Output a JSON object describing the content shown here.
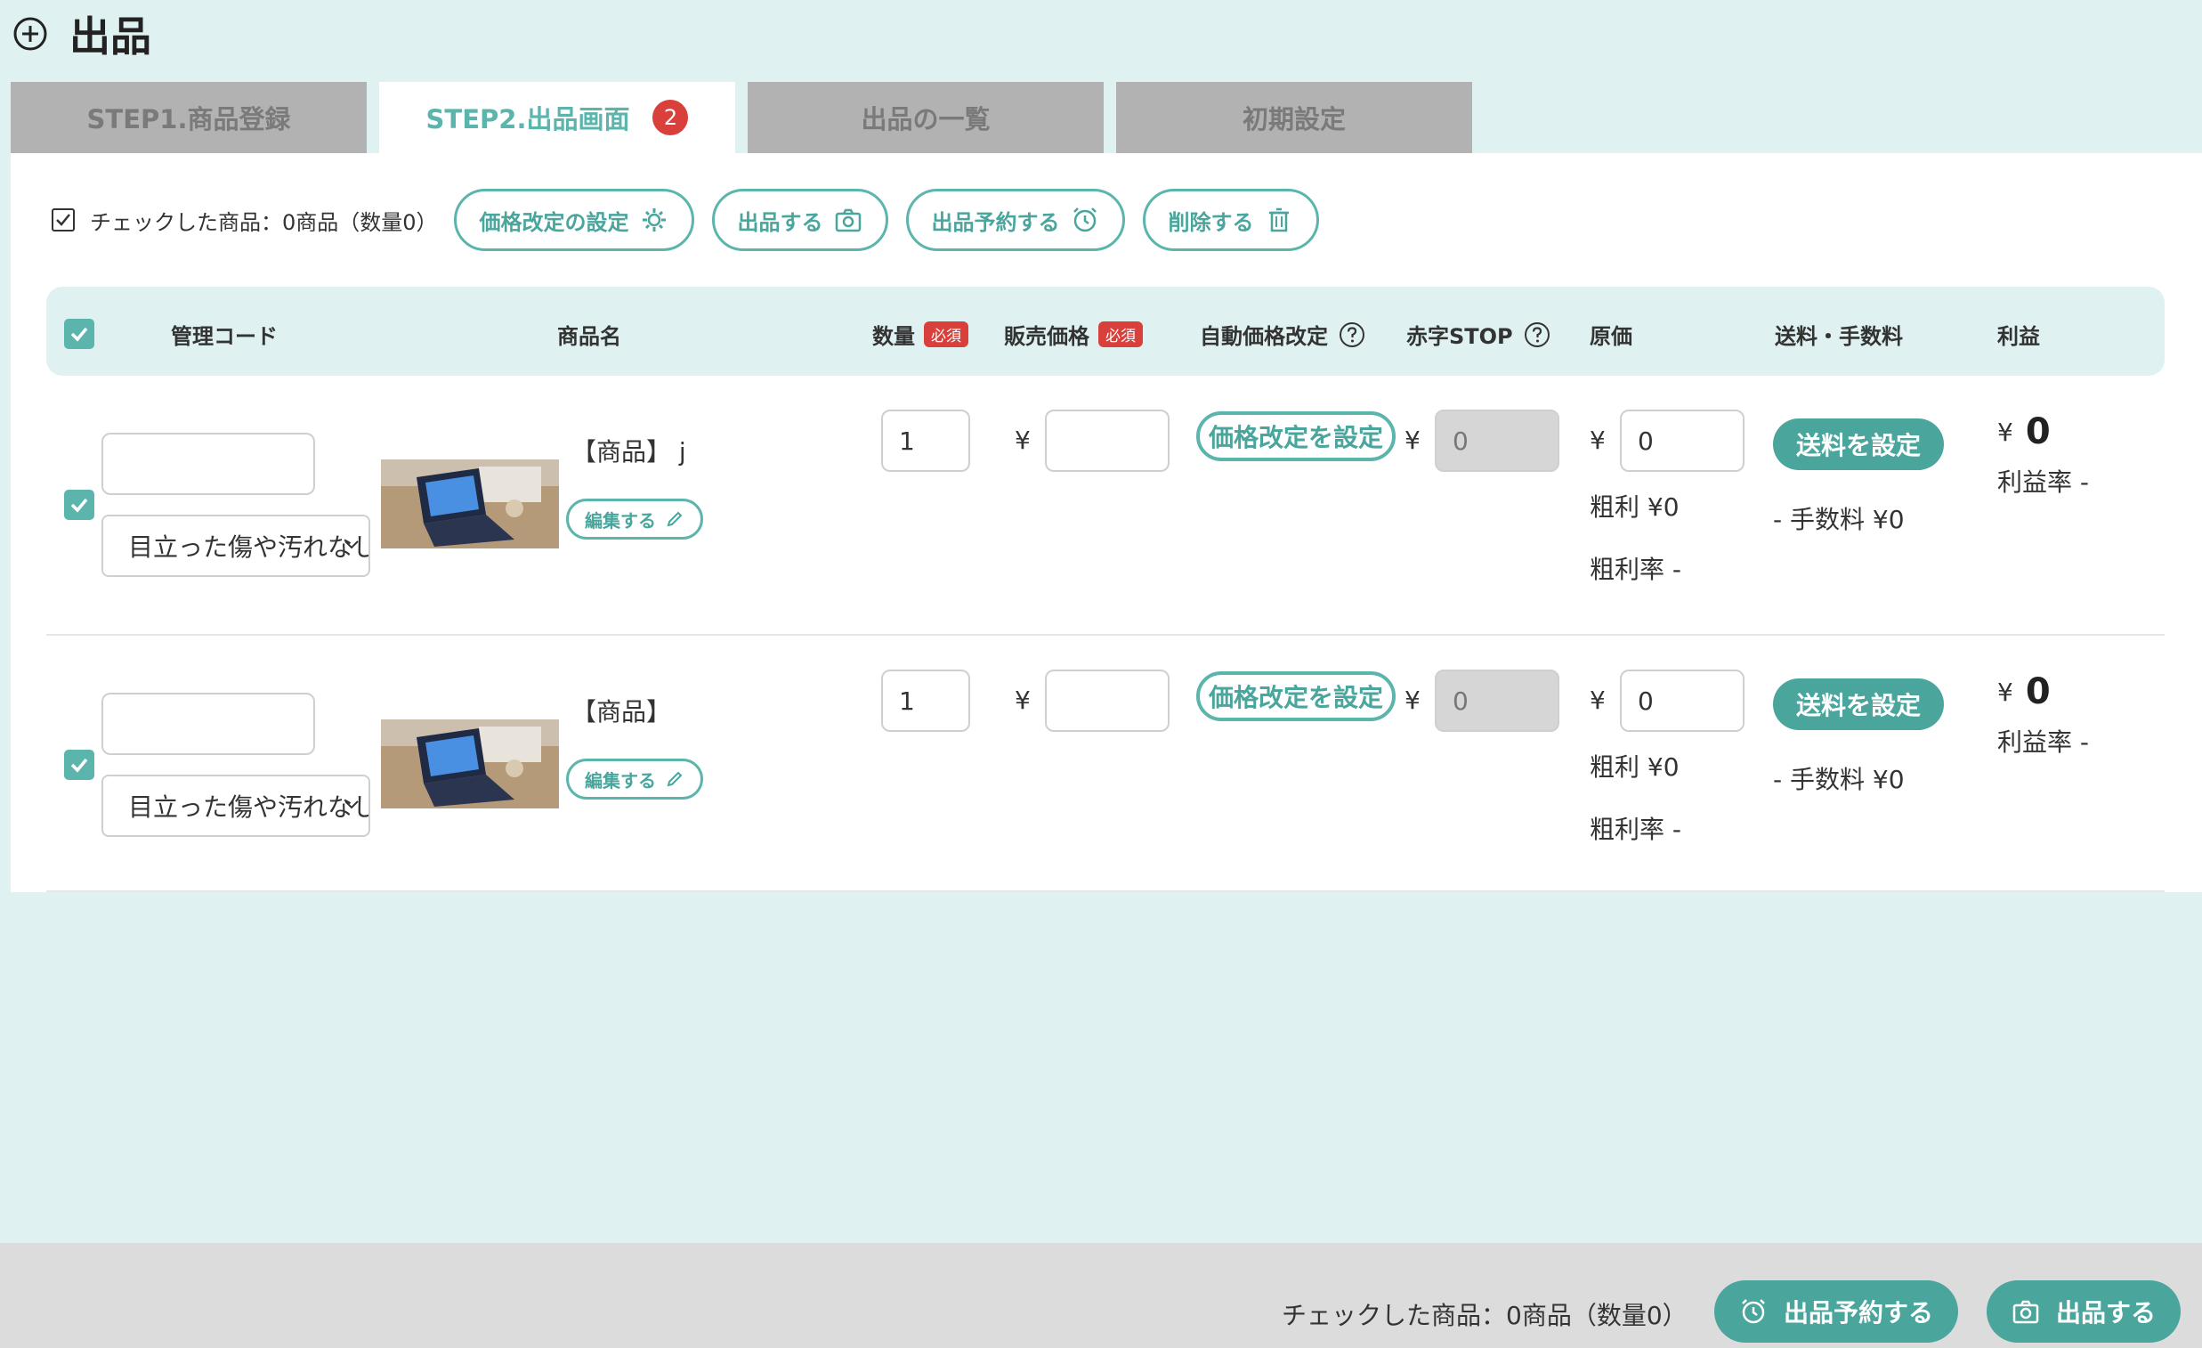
{
  "page": {
    "title": "出品"
  },
  "tabs": [
    {
      "label": "STEP1.商品登録"
    },
    {
      "label": "STEP2.出品画面",
      "badge": "2",
      "active": true
    },
    {
      "label": "出品の一覧"
    },
    {
      "label": "初期設定"
    }
  ],
  "toolbar": {
    "checked_summary": "チェックした商品：0商品（数量0）",
    "price_revision_button": "価格改定の設定",
    "list_button": "出品する",
    "schedule_button": "出品予約する",
    "delete_button": "削除する"
  },
  "table": {
    "headers": {
      "code": "管理コード",
      "name": "商品名",
      "quantity": "数量",
      "sale_price": "販売価格",
      "required": "必須",
      "auto_price": "自動価格改定",
      "loss_stop": "赤字STOP",
      "cost": "原価",
      "shipping": "送料・手数料",
      "profit": "利益"
    },
    "rows": [
      {
        "code": "",
        "condition": "目立った傷や汚れなし",
        "name": "【商品】 j",
        "edit_label": "編集する",
        "quantity": "1",
        "yen": "¥",
        "sale_price": "",
        "price_setting_label": "価格改定を設定",
        "loss_stop_value": "0",
        "cost_value": "0",
        "gross_profit": "粗利 ¥0",
        "gross_margin": "粗利率 -",
        "shipping_button": "送料を設定",
        "fee": "- 手数料 ¥0",
        "profit_value": "0",
        "profit_rate": "利益率 -"
      },
      {
        "code": "",
        "condition": "目立った傷や汚れなし",
        "name": "【商品】",
        "edit_label": "編集する",
        "quantity": "1",
        "yen": "¥",
        "sale_price": "",
        "price_setting_label": "価格改定を設定",
        "loss_stop_value": "0",
        "cost_value": "0",
        "gross_profit": "粗利 ¥0",
        "gross_margin": "粗利率 -",
        "shipping_button": "送料を設定",
        "fee": "- 手数料 ¥0",
        "profit_value": "0",
        "profit_rate": "利益率 -"
      }
    ]
  },
  "footer": {
    "checked_summary": "チェックした商品：0商品（数量0）",
    "schedule_button": "出品予約する",
    "list_button": "出品する"
  },
  "colors": {
    "accent": "#5cb5ad",
    "required": "#d9403c",
    "background": "#dff1f1",
    "tab_inactive": "#b2b2b2"
  }
}
